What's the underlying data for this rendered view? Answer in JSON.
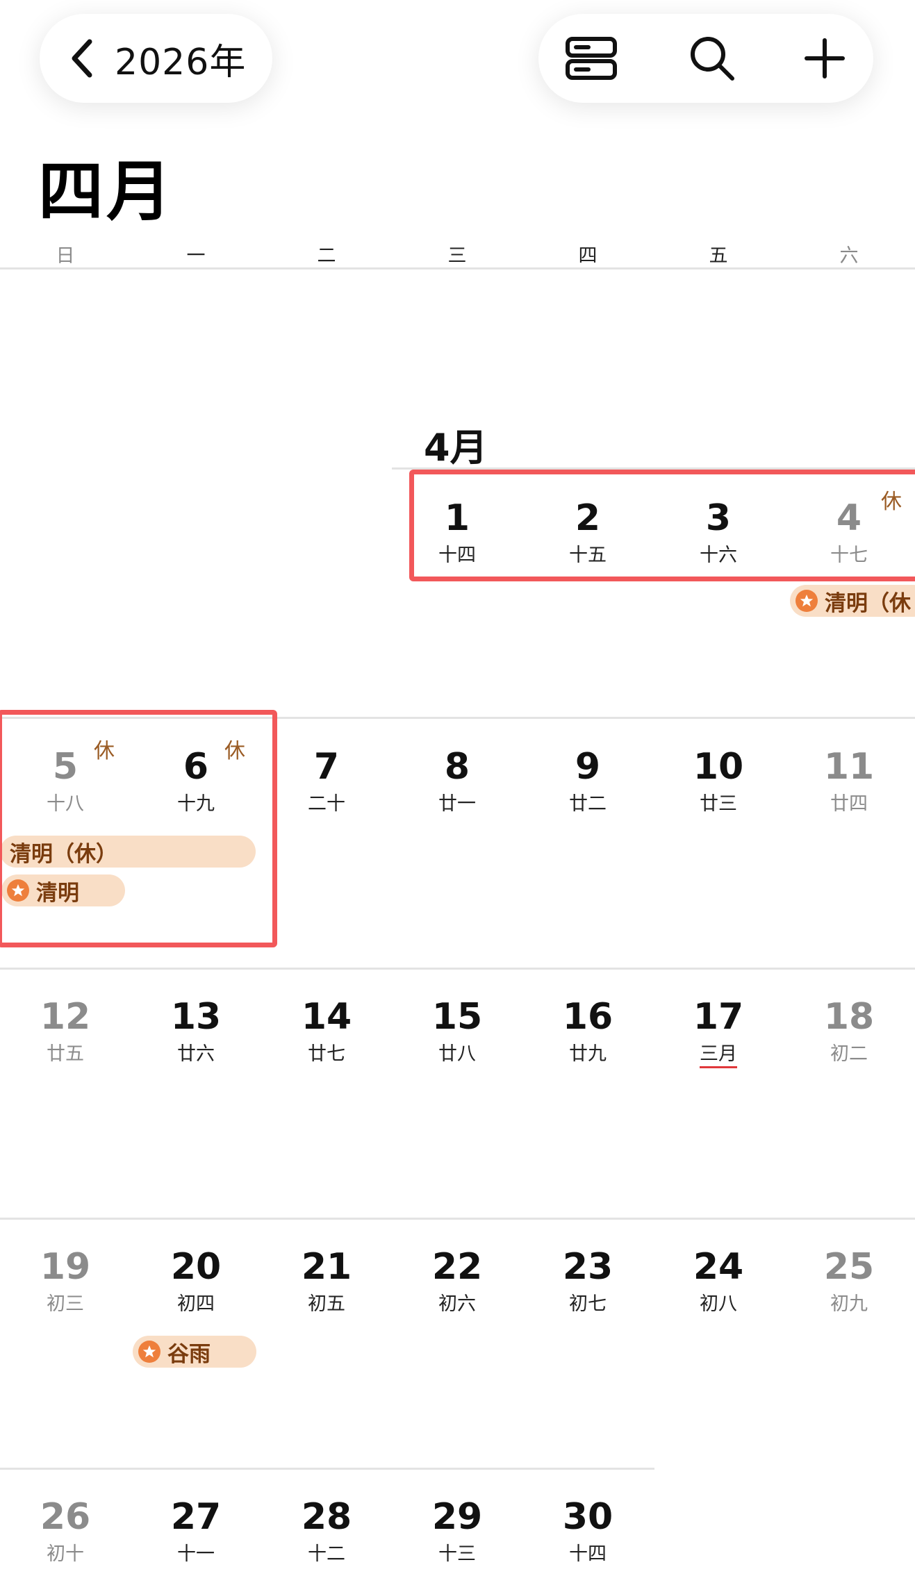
{
  "header": {
    "back_label": "2026年",
    "back_icon": "chevron-left-icon",
    "tools": [
      {
        "name": "view-toggle-icon"
      },
      {
        "name": "search-icon"
      },
      {
        "name": "add-icon"
      }
    ]
  },
  "month_title": "四月",
  "weekdays": [
    "日",
    "一",
    "二",
    "三",
    "四",
    "五",
    "六"
  ],
  "inline_month_label": "4月",
  "rest_label": "休",
  "days": [
    {
      "n": "1",
      "l": "十四"
    },
    {
      "n": "2",
      "l": "十五"
    },
    {
      "n": "3",
      "l": "十六"
    },
    {
      "n": "4",
      "l": "十七"
    },
    {
      "n": "5",
      "l": "十八"
    },
    {
      "n": "6",
      "l": "十九"
    },
    {
      "n": "7",
      "l": "二十"
    },
    {
      "n": "8",
      "l": "廿一"
    },
    {
      "n": "9",
      "l": "廿二"
    },
    {
      "n": "10",
      "l": "廿三"
    },
    {
      "n": "11",
      "l": "廿四"
    },
    {
      "n": "12",
      "l": "廿五"
    },
    {
      "n": "13",
      "l": "廿六"
    },
    {
      "n": "14",
      "l": "廿七"
    },
    {
      "n": "15",
      "l": "廿八"
    },
    {
      "n": "16",
      "l": "廿九"
    },
    {
      "n": "17",
      "l": "三月"
    },
    {
      "n": "18",
      "l": "初二"
    },
    {
      "n": "19",
      "l": "初三"
    },
    {
      "n": "20",
      "l": "初四"
    },
    {
      "n": "21",
      "l": "初五"
    },
    {
      "n": "22",
      "l": "初六"
    },
    {
      "n": "23",
      "l": "初七"
    },
    {
      "n": "24",
      "l": "初八"
    },
    {
      "n": "25",
      "l": "初九"
    },
    {
      "n": "26",
      "l": "初十"
    },
    {
      "n": "27",
      "l": "十一"
    },
    {
      "n": "28",
      "l": "十二"
    },
    {
      "n": "29",
      "l": "十三"
    },
    {
      "n": "30",
      "l": "十四"
    }
  ],
  "events": {
    "qingming_holiday_week1": "清明（休",
    "qingming_holiday": "清明（休）",
    "qingming": "清明",
    "guyu": "谷雨"
  },
  "colors": {
    "event_bg": "#f9dec6",
    "event_text": "#7a3c0e",
    "star": "#ee7f3c",
    "highlight": "#f2585a",
    "lunar_month_underline": "#e0383b"
  }
}
